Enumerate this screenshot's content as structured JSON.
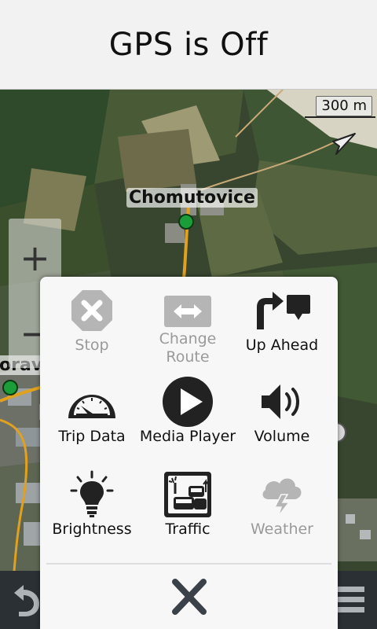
{
  "header": {
    "title": "GPS is Off"
  },
  "map": {
    "scale_label": "300 m",
    "city_label": "Chomutovice",
    "partial_city_label": "oravic",
    "zoom_in_label": "+",
    "zoom_out_label": "−"
  },
  "menu": {
    "items": [
      {
        "label": "Stop",
        "icon": "stop-icon",
        "enabled": false
      },
      {
        "label_line1": "Change",
        "label_line2": "Route",
        "icon": "change-route-icon",
        "enabled": false
      },
      {
        "label": "Up Ahead",
        "icon": "up-ahead-icon",
        "enabled": true
      },
      {
        "label": "Trip Data",
        "icon": "speedometer-icon",
        "enabled": true
      },
      {
        "label": "Media Player",
        "icon": "play-icon",
        "enabled": true
      },
      {
        "label": "Volume",
        "icon": "volume-icon",
        "enabled": true
      },
      {
        "label": "Brightness",
        "icon": "lightbulb-icon",
        "enabled": true
      },
      {
        "label": "Traffic",
        "icon": "traffic-icon",
        "enabled": true
      },
      {
        "label": "Weather",
        "icon": "weather-icon",
        "enabled": false
      }
    ],
    "close_icon": "close-icon"
  },
  "bottom_bar": {
    "back_icon": "back-icon",
    "menu_icon": "hamburger-menu-icon"
  },
  "colors": {
    "disabled": "#b5b5b5",
    "enabled": "#222222",
    "road": "#e0a020"
  }
}
